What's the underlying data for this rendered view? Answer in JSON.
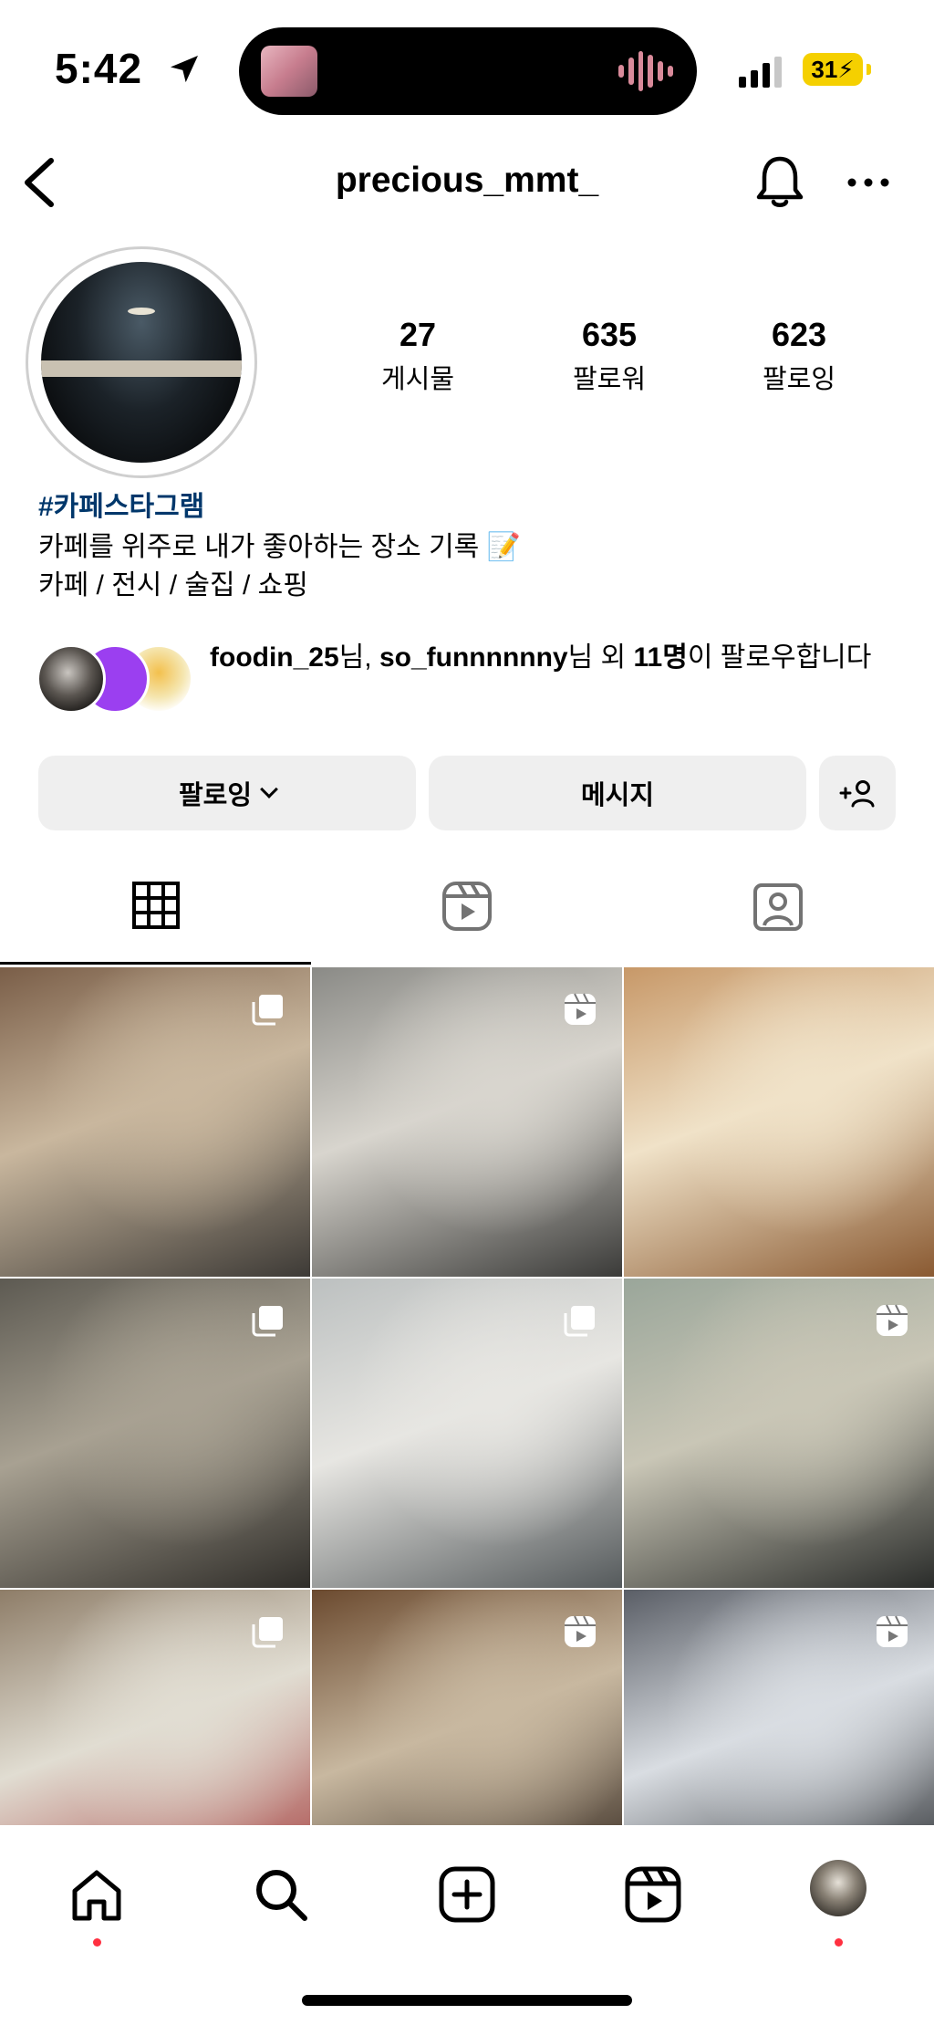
{
  "status_bar": {
    "time": "5:42",
    "battery": "31"
  },
  "header": {
    "username": "precious_mmt_"
  },
  "profile": {
    "stats": [
      {
        "value": "27",
        "label": "게시물"
      },
      {
        "value": "635",
        "label": "팔로워"
      },
      {
        "value": "623",
        "label": "팔로잉"
      }
    ],
    "hashtag": "#카페스타그램",
    "bio_line1": "카페를 위주로 내가 좋아하는 장소 기록 📝",
    "bio_line2": "카페 / 전시 / 술집 / 쇼핑"
  },
  "mutual": {
    "user1": "foodin_25",
    "suffix1": "님, ",
    "user2": "so_funnnnnny",
    "suffix2": "님 외 ",
    "count": "11명",
    "suffix3": "이 팔로우합니다"
  },
  "actions": {
    "following": "팔로잉",
    "message": "메시지",
    "add_user": "+👤"
  },
  "grid": {
    "posts": [
      {
        "kind": "carousel",
        "colors": [
          "#7a5e48",
          "#c9b79e",
          "#3d3a36"
        ]
      },
      {
        "kind": "reel",
        "colors": [
          "#8a8a86",
          "#d8d5ce",
          "#3b3b39"
        ]
      },
      {
        "kind": "none",
        "colors": [
          "#c79868",
          "#f0e2c8",
          "#8a5a32"
        ]
      },
      {
        "kind": "carousel",
        "colors": [
          "#5d5a52",
          "#a8a192",
          "#2f2d29"
        ]
      },
      {
        "kind": "carousel",
        "colors": [
          "#bcc0c0",
          "#e7e6e2",
          "#555a5c"
        ]
      },
      {
        "kind": "reel",
        "colors": [
          "#9aa69a",
          "#c9c6b6",
          "#2a2c2a"
        ]
      },
      {
        "kind": "carousel",
        "colors": [
          "#8e7d68",
          "#e1ddd2",
          "#a33a3a"
        ]
      },
      {
        "kind": "reel",
        "colors": [
          "#6b4a2f",
          "#c8b8a0",
          "#2a1e16"
        ]
      },
      {
        "kind": "reel",
        "colors": [
          "#5a5e66",
          "#d9dde2",
          "#1f2226"
        ]
      }
    ]
  },
  "colors": {
    "link": "#00376b",
    "button_bg": "#efefef",
    "notification_dot": "#ff3040",
    "battery": "#f5d000"
  }
}
